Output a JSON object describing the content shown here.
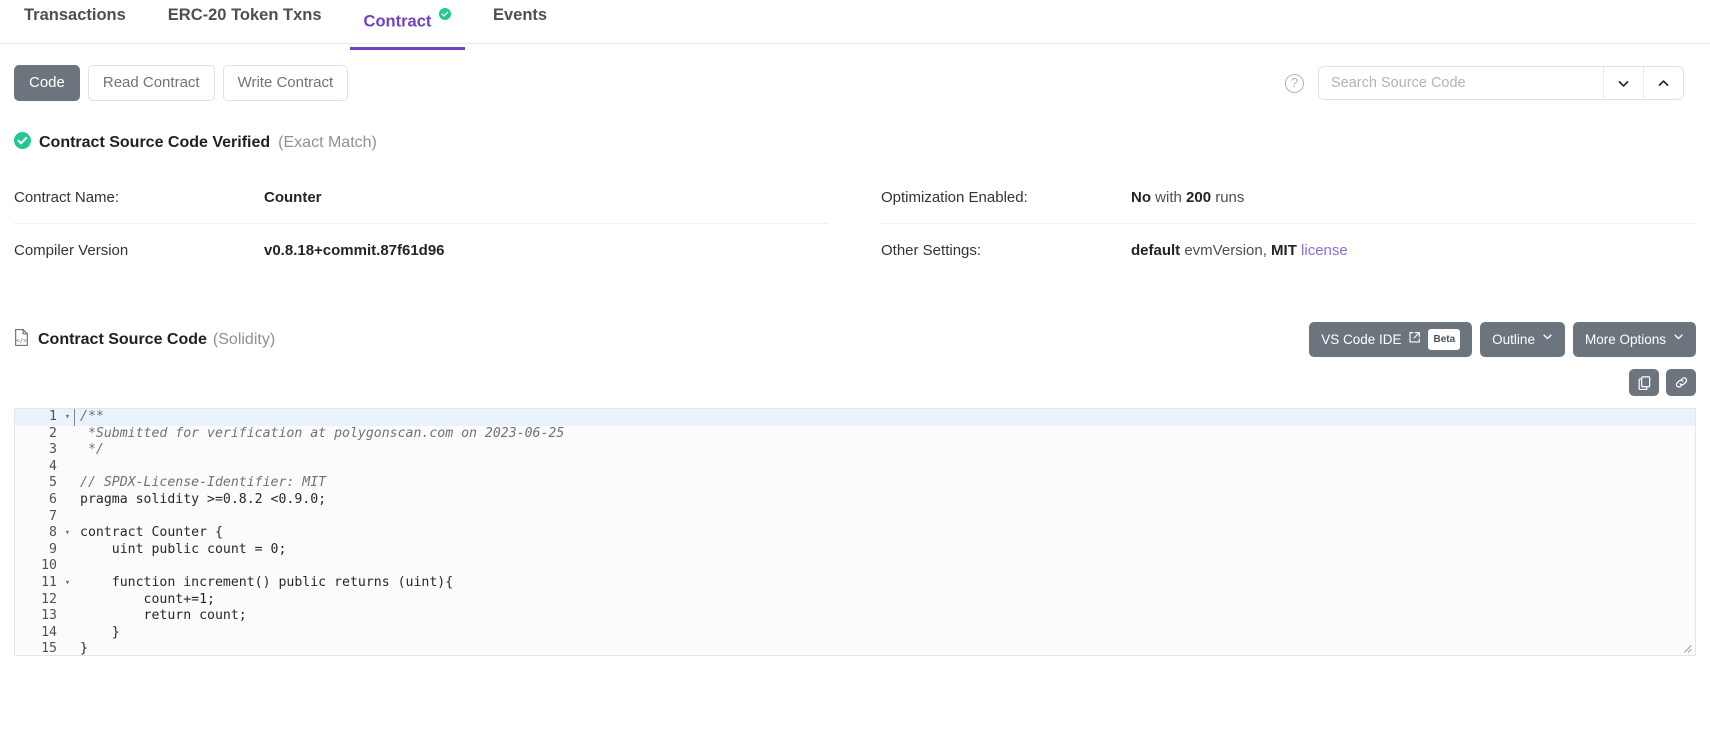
{
  "tabs": [
    {
      "label": "Transactions",
      "active": false,
      "verified": false
    },
    {
      "label": "ERC-20 Token Txns",
      "active": false,
      "verified": false
    },
    {
      "label": "Contract",
      "active": true,
      "verified": true
    },
    {
      "label": "Events",
      "active": false,
      "verified": false
    }
  ],
  "actions": {
    "code_label": "Code",
    "read_label": "Read Contract",
    "write_label": "Write Contract",
    "help_icon": "question-circle-icon",
    "search_placeholder": "Search Source Code",
    "search_value": "",
    "prev_icon": "chevron-down-icon",
    "next_icon": "chevron-up-icon"
  },
  "verified": {
    "icon": "check-circle-icon",
    "title": "Contract Source Code Verified",
    "subtitle": "(Exact Match)",
    "accent": "#21c795"
  },
  "info": {
    "left": [
      {
        "label": "Contract Name:",
        "value_bold": "Counter",
        "value_rest": ""
      },
      {
        "label": "Compiler Version",
        "value_bold": "v0.8.18+commit.87f61d96",
        "value_rest": ""
      }
    ],
    "right": [
      {
        "label": "Optimization Enabled:",
        "value_bold": "No",
        "value_mid": " with ",
        "value_bold2": "200",
        "value_rest": " runs"
      },
      {
        "label": "Other Settings:",
        "value_bold": "default",
        "value_mid": " evmVersion, ",
        "value_bold2": "MIT",
        "value_link": " license"
      }
    ]
  },
  "source": {
    "icon": "file-code-icon",
    "title": "Contract Source Code",
    "subtitle": "(Solidity)",
    "vscode_label": "VS Code IDE",
    "vscode_external_icon": "external-link-icon",
    "beta_badge": "Beta",
    "outline_label": "Outline",
    "more_options_label": "More Options",
    "copy_icon": "copy-icon",
    "link_icon": "link-icon"
  },
  "code": {
    "language": "solidity",
    "lines": [
      {
        "n": 1,
        "fold": true,
        "highlight": true,
        "text": "/**",
        "style": "comment"
      },
      {
        "n": 2,
        "fold": false,
        "highlight": false,
        "text": " *Submitted for verification at polygonscan.com on 2023-06-25",
        "style": "comment"
      },
      {
        "n": 3,
        "fold": false,
        "highlight": false,
        "text": " */",
        "style": "comment"
      },
      {
        "n": 4,
        "fold": false,
        "highlight": false,
        "text": "",
        "style": "plain"
      },
      {
        "n": 5,
        "fold": false,
        "highlight": false,
        "text": "// SPDX-License-Identifier: MIT",
        "style": "comment"
      },
      {
        "n": 6,
        "fold": false,
        "highlight": false,
        "text": "pragma solidity >=0.8.2 <0.9.0;",
        "style": "plain"
      },
      {
        "n": 7,
        "fold": false,
        "highlight": false,
        "text": "",
        "style": "plain"
      },
      {
        "n": 8,
        "fold": true,
        "highlight": false,
        "text": "contract Counter {",
        "style": "plain"
      },
      {
        "n": 9,
        "fold": false,
        "highlight": false,
        "text": "    uint public count = 0;",
        "style": "plain"
      },
      {
        "n": 10,
        "fold": false,
        "highlight": false,
        "text": "",
        "style": "plain"
      },
      {
        "n": 11,
        "fold": true,
        "highlight": false,
        "text": "    function increment() public returns (uint){",
        "style": "plain"
      },
      {
        "n": 12,
        "fold": false,
        "highlight": false,
        "text": "        count+=1;",
        "style": "plain"
      },
      {
        "n": 13,
        "fold": false,
        "highlight": false,
        "text": "        return count;",
        "style": "plain"
      },
      {
        "n": 14,
        "fold": false,
        "highlight": false,
        "text": "    }",
        "style": "plain"
      },
      {
        "n": 15,
        "fold": false,
        "highlight": false,
        "text": "}",
        "style": "plain"
      }
    ]
  },
  "colors": {
    "accent_purple": "#6f42c1",
    "verified_green": "#21c795",
    "btn_gray": "#6c757d",
    "link_purple": "#8b6fd1"
  }
}
